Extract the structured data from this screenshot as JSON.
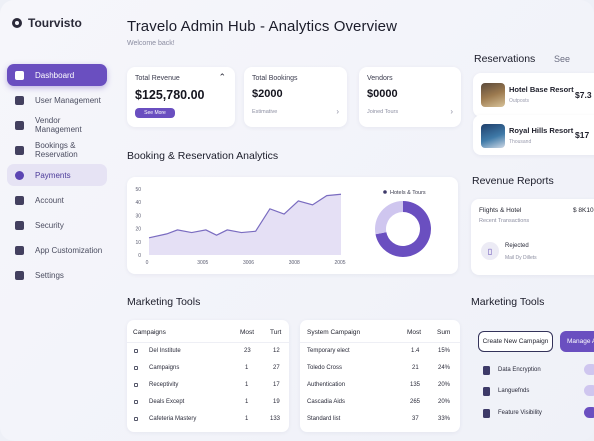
{
  "brand": {
    "name": "Tourvisto"
  },
  "sidebar": {
    "items": [
      {
        "label": "Dashboard",
        "icon": "home-icon",
        "state": "active"
      },
      {
        "label": "User Management",
        "icon": "users-icon",
        "state": ""
      },
      {
        "label": "Vendor Management",
        "icon": "store-icon",
        "state": ""
      },
      {
        "label": "Bookings & Reservation",
        "icon": "calendar-icon",
        "state": ""
      },
      {
        "label": "Payments",
        "icon": "payment-icon",
        "state": "soft"
      },
      {
        "label": "Account",
        "icon": "account-icon",
        "state": ""
      },
      {
        "label": "Security",
        "icon": "shield-icon",
        "state": ""
      },
      {
        "label": "App Customization",
        "icon": "palette-icon",
        "state": ""
      },
      {
        "label": "Settings",
        "icon": "gear-icon",
        "state": ""
      }
    ]
  },
  "header": {
    "title": "Travelo Admin Hub - Analytics Overview",
    "subtitle": "Welcome back!"
  },
  "stats": {
    "revenue": {
      "label": "Total Revenue",
      "value": "$125,780.00",
      "button": "See More"
    },
    "bookings": {
      "label": "Total Bookings",
      "value": "$2000",
      "sub": "Estimative"
    },
    "vendors": {
      "label": "Vendors",
      "value": "$0000",
      "sub": "Joined Tours"
    }
  },
  "booking_section": {
    "title": "Booking & Reservation Analytics"
  },
  "chart_data": {
    "type": "line",
    "title": "",
    "x": [
      0,
      500,
      800,
      1200,
      1600,
      1900,
      2200,
      2600,
      3000,
      3400,
      3800,
      4200,
      4600,
      5000,
      5400
    ],
    "series": [
      {
        "values": [
          13,
          16,
          19,
          17,
          19,
          15,
          19,
          17,
          18,
          35,
          31,
          41,
          38,
          45,
          46
        ]
      }
    ],
    "x_ticks": [
      "0",
      "3005",
      "3006",
      "3008",
      "2005"
    ],
    "y_ticks": [
      "0",
      "10",
      "20",
      "30",
      "40",
      "50"
    ],
    "ylim": [
      0,
      50
    ],
    "legend": [
      "Hotels & Tours"
    ],
    "donut": {
      "values": [
        72,
        28
      ],
      "colors": [
        "#6a4fc0",
        "#cfc6ef"
      ]
    },
    "colors": {
      "line": "#7a6cc0",
      "fill": "#dcd6f2"
    },
    "grid": false
  },
  "right": {
    "reservations_title": "Reservations",
    "see_all": "See",
    "reservations": [
      {
        "name": "Hotel Base Resort",
        "meta": "Outposts",
        "price": "$7.3"
      },
      {
        "name": "Royal Hills Resort",
        "meta": "Thousand",
        "price": "$17"
      }
    ],
    "revenue_title": "Revenue Reports",
    "revenue": {
      "row_label": "Flights & Hotel",
      "row_value": "$ 8K10",
      "row_sub": "Recent Transactions",
      "item_title": "Rejected",
      "item_sub": "Mail Dy Dillets"
    }
  },
  "marketing": {
    "title": "Marketing Tools",
    "table1": {
      "headers": [
        "Campaigns",
        "Most",
        "Turt"
      ],
      "rows": [
        [
          "Del Institute",
          "23",
          "12"
        ],
        [
          "Campaigns",
          "1",
          "27"
        ],
        [
          "Receptivity",
          "1",
          "17"
        ],
        [
          "Deals Except",
          "1",
          "19"
        ],
        [
          "Cafeteria Mastery",
          "1",
          "133"
        ]
      ]
    },
    "table2": {
      "headers": [
        "System Campaign",
        "Most",
        "Sum"
      ],
      "rows": [
        [
          "Temporary elect",
          "1.4",
          "15%"
        ],
        [
          "Toledo Cross",
          "21",
          "24%"
        ],
        [
          "Authentication",
          "135",
          "20%"
        ],
        [
          "Cascadia Aids",
          "265",
          "20%"
        ],
        [
          "Standard list",
          "37",
          "33%"
        ]
      ]
    }
  },
  "marketing_right": {
    "title": "Marketing Tools",
    "create_button": "Create New Campaign",
    "manage_button": "Manage A",
    "items": [
      {
        "label": "Data Encryption",
        "toggle": false
      },
      {
        "label": "Languefnds",
        "toggle": false
      },
      {
        "label": "Feature Visibility",
        "toggle": true
      }
    ]
  }
}
